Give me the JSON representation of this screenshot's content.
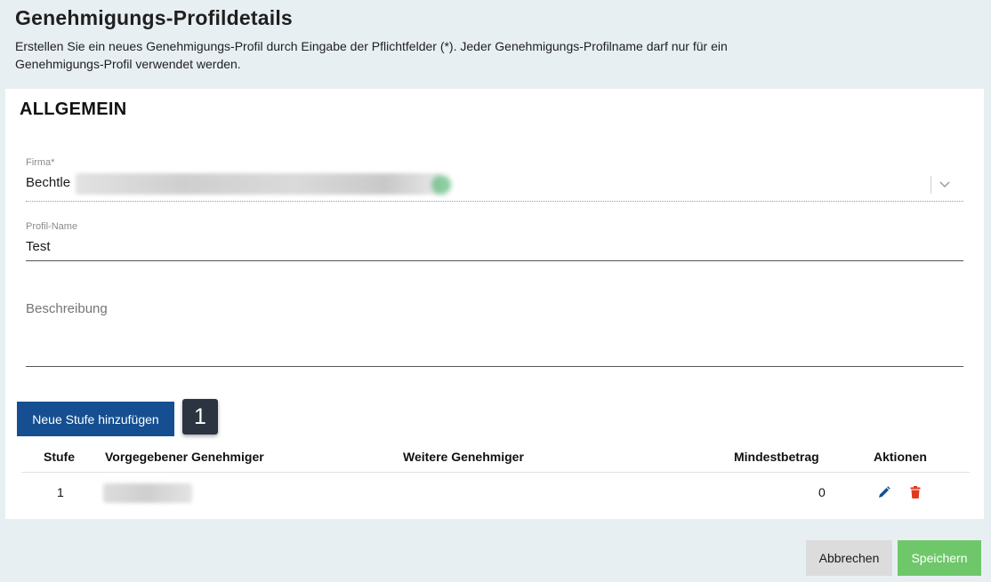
{
  "header": {
    "title": "Genehmigungs-Profildetails",
    "description": "Erstellen Sie ein neues Genehmigungs-Profil durch Eingabe der Pflichtfelder (*). Jeder Genehmigungs-Profilname darf nur für ein Genehmigungs-Profil verwendet werden."
  },
  "section": {
    "title": "ALLGEMEIN"
  },
  "fields": {
    "firma": {
      "label": "Firma*",
      "value": "Bechtle"
    },
    "profil_name": {
      "label": "Profil-Name",
      "value": "Test"
    },
    "beschreibung": {
      "placeholder": "Beschreibung"
    }
  },
  "actions": {
    "add_step_label": "Neue Stufe hinzufügen",
    "step_badge": "1"
  },
  "table": {
    "columns": {
      "stufe": "Stufe",
      "vorgegebener": "Vorgegebener Genehmiger",
      "weitere": "Weitere Genehmiger",
      "mindestbetrag": "Mindestbetrag",
      "aktionen": "Aktionen"
    },
    "rows": [
      {
        "stufe": "1",
        "weitere": "",
        "mindestbetrag": "0"
      }
    ]
  },
  "footer": {
    "cancel_label": "Abbrechen",
    "save_label": "Speichern"
  },
  "colors": {
    "primary": "#154f91",
    "save": "#6ec86a",
    "delete": "#e03a1e",
    "background": "#e8eff3"
  },
  "icons": [
    "chevron-down-icon",
    "pencil-icon",
    "trash-icon"
  ]
}
